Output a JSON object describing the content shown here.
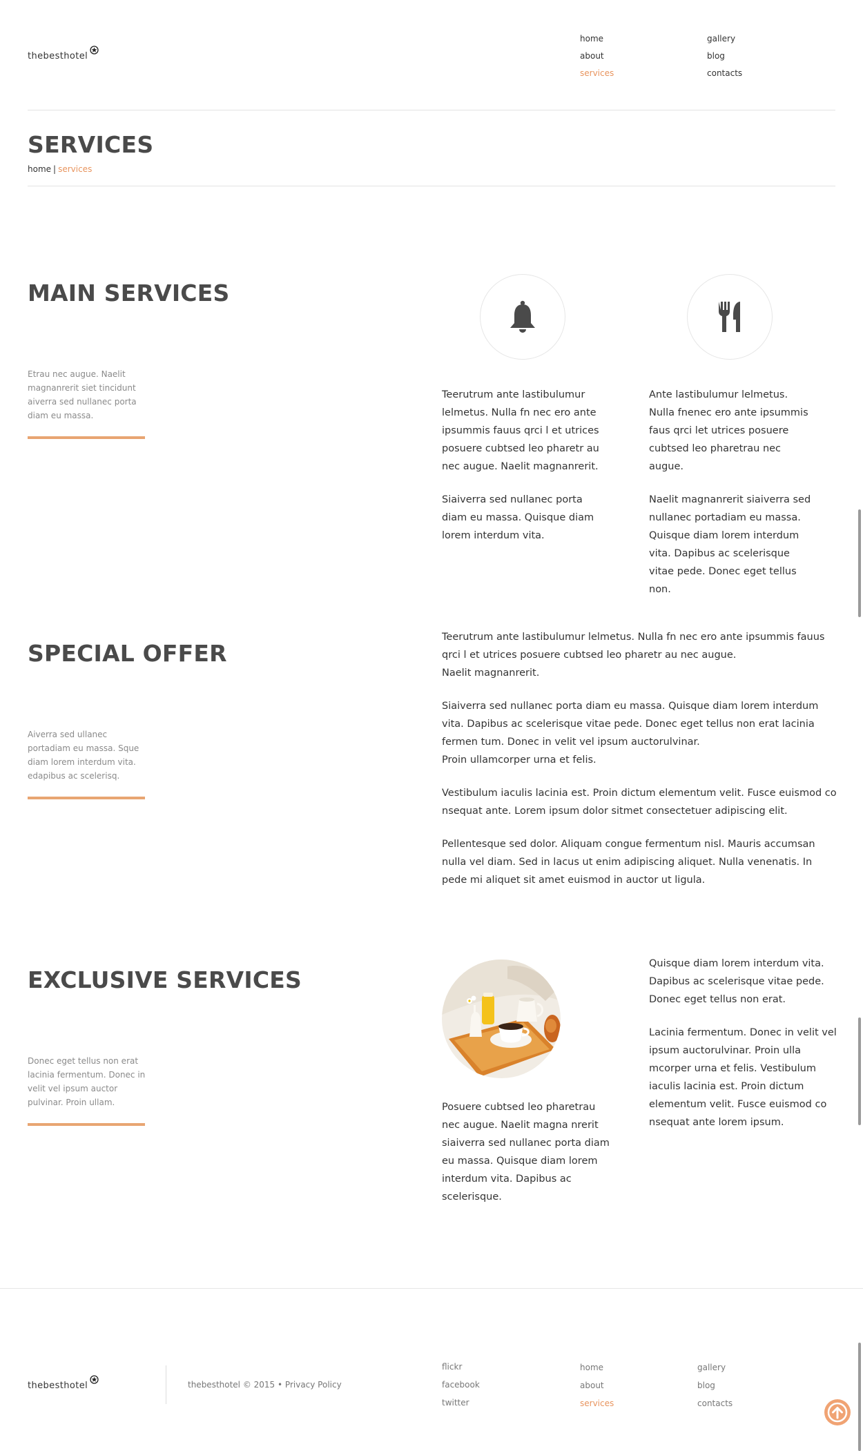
{
  "header": {
    "logo": "thebesthotel",
    "nav_col1": [
      {
        "label": "home",
        "active": false
      },
      {
        "label": "about",
        "active": false
      },
      {
        "label": "services",
        "active": true
      }
    ],
    "nav_col2": [
      {
        "label": "gallery",
        "active": false
      },
      {
        "label": "blog",
        "active": false
      },
      {
        "label": "contacts",
        "active": false
      }
    ]
  },
  "page": {
    "title": "SERVICES",
    "breadcrumb_home": "home",
    "breadcrumb_sep": "|",
    "breadcrumb_current": "services"
  },
  "main_services": {
    "title": "MAIN SERVICES",
    "desc": "Etrau nec augue. Naelit magnanrerit siet tincidunt aiverra sed nullanec porta diam eu massa.",
    "icon1": "bell-icon",
    "icon2": "fork-knife-icon",
    "col1_p1": "Teerutrum ante lastibulumur lelmetus. Nulla fn nec ero ante ipsummis fauus qrci l et utrices posuere cubtsed leo pharetr au nec augue. Naelit magnanrerit.",
    "col1_p2": "Siaiverra sed nullanec porta diam eu massa. Quisque diam lorem interdum vita.",
    "col2_p1": "Ante lastibulumur lelmetus. Nulla fnenec ero ante ipsummis faus qrci let utrices posuere cubtsed leo pharetrau nec augue.",
    "col2_p2": "Naelit magnanrerit siaiverra sed nullanec portadiam eu massa. Quisque diam lorem interdum vita. Dapibus ac scelerisque vitae pede. Donec eget tellus non."
  },
  "special_offer": {
    "title": "SPECIAL OFFER",
    "desc": "Aiverra sed ullanec portadiam eu massa. Sque diam lorem interdum vita. edapibus ac scelerisq.",
    "p1a": "Teerutrum ante lastibulumur lelmetus. Nulla fn nec ero ante ipsummis fauus qrci l et utrices posuere cubtsed leo pharetr au nec augue.",
    "p1b": "Naelit magnanrerit.",
    "p2a": "Siaiverra sed nullanec porta diam eu massa. Quisque diam lorem interdum vita. Dapibus ac scelerisque vitae pede. Donec eget tellus non erat lacinia fermen tum. Donec in velit vel ipsum auctorulvinar.",
    "p2b": "Proin ullamcorper urna et felis.",
    "p3": "Vestibulum iaculis lacinia est. Proin dictum elementum velit. Fusce euismod co nsequat ante. Lorem ipsum dolor sitmet consectetuer adipiscing elit.",
    "p4": "Pellentesque sed dolor. Aliquam congue fermentum nisl. Mauris accumsan nulla vel diam. Sed in lacus ut enim adipiscing aliquet. Nulla venenatis. In pede mi aliquet sit amet euismod in auctor ut ligula."
  },
  "exclusive": {
    "title": "EXCLUSIVE SERVICES",
    "desc": "Donec eget tellus non erat lacinia fermentum. Donec in velit vel ipsum auctor pulvinar. Proin ullam.",
    "col1_p": "Posuere cubtsed leo pharetrau nec augue. Naelit magna nrerit siaiverra sed nullanec porta diam eu massa. Quisque diam lorem interdum vita. Dapibus ac scelerisque.",
    "col2_p1": "Quisque diam lorem interdum vita. Dapibus ac scelerisque vitae pede. Donec eget tellus non erat.",
    "col2_p2": "Lacinia fermentum. Donec in velit vel ipsum auctorulvinar. Proin ulla mcorper urna et felis. Vestibulum iaculis lacinia est. Proin dictum elementum velit. Fusce euismod co nsequat ante lorem ipsum."
  },
  "footer": {
    "logo": "thebesthotel",
    "copyright": "thebesthotel © 2015 •",
    "privacy": "Privacy Policy",
    "social": [
      "flickr",
      "facebook",
      "twitter"
    ],
    "nav_col1": [
      {
        "label": "home",
        "active": false
      },
      {
        "label": "about",
        "active": false
      },
      {
        "label": "services",
        "active": true
      }
    ],
    "nav_col2": [
      {
        "label": "gallery",
        "active": false
      },
      {
        "label": "blog",
        "active": false
      },
      {
        "label": "contacts",
        "active": false
      }
    ]
  },
  "colors": {
    "accent": "#e8945e",
    "accent_line": "#e8a572",
    "heading": "#4a4a4a"
  }
}
